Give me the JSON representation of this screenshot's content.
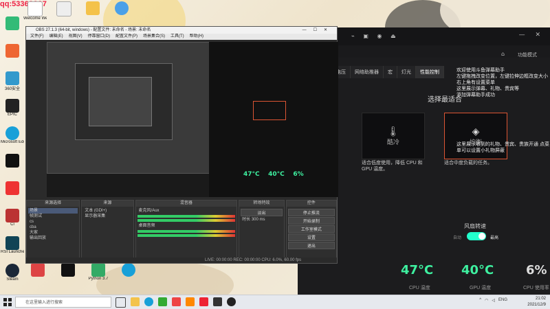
{
  "watermark": "qq:5336???7",
  "desktop": {
    "top_icons": [
      {
        "label": "Welcome Wedesk...",
        "color": "#fff"
      },
      {
        "label": "",
        "color": "#eee"
      },
      {
        "label": "",
        "color": "#f4c24a"
      },
      {
        "label": "",
        "color": "#4aa0e8"
      }
    ],
    "left_icons": [
      {
        "label": "",
        "color": "#3b7"
      },
      {
        "label": "",
        "color": "#e63"
      },
      {
        "label": "360安全",
        "color": "#39c"
      },
      {
        "label": "EPIC",
        "color": "#222"
      },
      {
        "label": "Microsoft Edge",
        "color": "#18a0d8"
      },
      {
        "label": "",
        "color": "#111"
      },
      {
        "label": "",
        "color": "#e33"
      },
      {
        "label": "Cl",
        "color": "#b33"
      },
      {
        "label": "RSI Launcher",
        "color": "#145"
      },
      {
        "label": "Steam",
        "color": "#1b2838"
      }
    ],
    "bottom_icons": [
      {
        "label": "",
        "color": "#d44"
      },
      {
        "label": "",
        "color": "#111"
      },
      {
        "label": "Python 3.7",
        "color": "#3a6"
      },
      {
        "label": "",
        "color": "#18a0d8"
      }
    ]
  },
  "obs": {
    "title": "OBS 27.1.3 (64-bit, windows) - 配置文件: 未命名 - 场景: 未命名",
    "window_controls": [
      "—",
      "☐",
      "✕"
    ],
    "menu": [
      "文件(F)",
      "编辑(E)",
      "视图(V)",
      "停靠窗口(D)",
      "配置文件(P)",
      "场景集合(S)",
      "工具(T)",
      "帮助(H)"
    ],
    "panels": {
      "scenes": {
        "title": "来源选择",
        "items": [
          "场景",
          "帧测试",
          "cs",
          "cba",
          "大家",
          "输出回放"
        ]
      },
      "sources": {
        "title": "来源",
        "items": [
          "文本 (GDI+)",
          "显示器采集"
        ]
      },
      "mixer": {
        "title": "混音器",
        "channels": [
          {
            "name": "麦克风/Aux",
            "db": "0.0 dB"
          },
          {
            "name": "桌面音频",
            "db": "0.0 dB"
          }
        ]
      },
      "transitions": {
        "title": "转场特效",
        "type": "淡出",
        "duration_label": "时长",
        "duration": "300 ms"
      },
      "controls": {
        "title": "控件",
        "buttons": [
          "停止推流",
          "开始录制",
          "工作室模式",
          "设置",
          "退出"
        ]
      }
    },
    "status": "LIVE: 00:00:00   REC: 00:00:00   CPU: 6.0%, 60.00 fps"
  },
  "control_center": {
    "tabs": [
      "电压",
      "网络助推器",
      "宏",
      "灯光",
      "性能控制"
    ],
    "active_tab": "性能控制",
    "heading": "选择最适合",
    "modes": [
      {
        "name": "酷冷",
        "active": false
      },
      {
        "name": "均衡",
        "active": true
      }
    ],
    "mode_desc_left": "适合低度使用，降低 CPU 和 GPU 温度。",
    "mode_desc_right": "适合中度负载的任务。",
    "tooltip_1": "欢迎使用斗鱼弹幕助手\n左键拖拽改变位置，左键拉伸边框改变大小\n右上角有设置菜单\n这里展示弹幕、礼物、贵宾等\n添加弹幕助手成功",
    "tooltip_2": "这里展示收到的礼物、贵宾、贵族开通\n点菜单可以设置小礼物屏蔽",
    "fan_title": "风扇转速",
    "fan_left": "自动",
    "fan_right": "最高",
    "temps": [
      {
        "value": "47°C",
        "label": "CPU 温度"
      },
      {
        "value": "40°C",
        "label": "GPU 温度"
      },
      {
        "value": "6%",
        "label": "CPU 使用率"
      }
    ],
    "accent": "#3ef0a0",
    "header_right": "功能模式"
  },
  "taskbar": {
    "search_placeholder": "在这里输入进行搜索",
    "tray_lang": "ENG",
    "time": "21:02",
    "date": "2021/12/9"
  }
}
